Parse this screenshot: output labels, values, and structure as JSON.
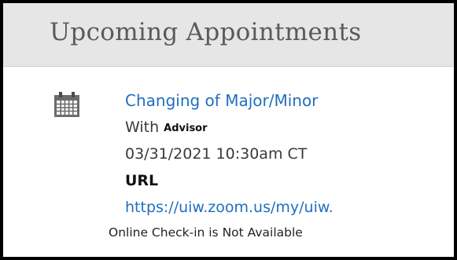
{
  "header": {
    "title": "Upcoming Appointments"
  },
  "appointment": {
    "icon": "calendar-icon",
    "title": "Changing of Major/Minor",
    "with_label": "With",
    "advisor": "Advisor",
    "datetime": "03/31/2021 10:30am CT",
    "url_label": "URL",
    "url": "https://uiw.zoom.us/my/uiw.",
    "checkin_status": "Online Check-in is Not Available"
  },
  "colors": {
    "header_bg": "#e6e6e6",
    "link": "#1f6fbf",
    "title_text": "#5a5a5a"
  }
}
